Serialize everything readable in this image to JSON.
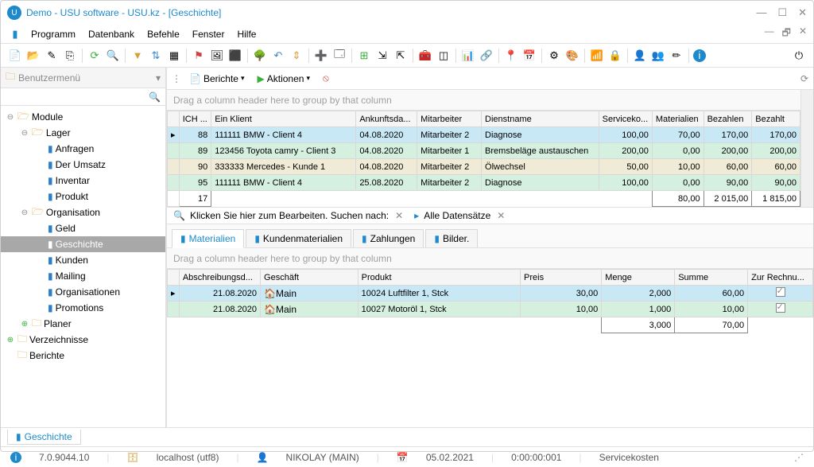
{
  "title": "Demo - USU software - USU.kz - [Geschichte]",
  "menu": [
    "Programm",
    "Datenbank",
    "Befehle",
    "Fenster",
    "Hilfe"
  ],
  "sidebar": {
    "title": "Benutzermenü",
    "items": [
      {
        "label": "Module"
      },
      {
        "label": "Lager"
      },
      {
        "label": "Anfragen"
      },
      {
        "label": "Der Umsatz"
      },
      {
        "label": "Inventar"
      },
      {
        "label": "Produkt"
      },
      {
        "label": "Organisation"
      },
      {
        "label": "Geld"
      },
      {
        "label": "Geschichte"
      },
      {
        "label": "Kunden"
      },
      {
        "label": "Mailing"
      },
      {
        "label": "Organisationen"
      },
      {
        "label": "Promotions"
      },
      {
        "label": "Planer"
      },
      {
        "label": "Verzeichnisse"
      },
      {
        "label": "Berichte"
      }
    ]
  },
  "mtoolbar": {
    "berichte": "Berichte",
    "aktionen": "Aktionen"
  },
  "group_hint": "Drag a column header here to group by that column",
  "grid1": {
    "cols": [
      "ICH ...",
      "Ein Klient",
      "Ankunftsda...",
      "Mitarbeiter",
      "Dienstname",
      "Serviceko...",
      "Materialien",
      "Bezahlen",
      "Bezahlt"
    ],
    "rows": [
      {
        "id": "88",
        "client": "111111 BMW - Client 4",
        "date": "04.08.2020",
        "emp": "Mitarbeiter 2",
        "svc": "Diagnose",
        "sk": "100,00",
        "mat": "70,00",
        "pay": "170,00",
        "paid": "170,00"
      },
      {
        "id": "89",
        "client": "123456 Toyota camry - Client 3",
        "date": "04.08.2020",
        "emp": "Mitarbeiter 1",
        "svc": "Bremsbeläge austauschen",
        "sk": "200,00",
        "mat": "0,00",
        "pay": "200,00",
        "paid": "200,00"
      },
      {
        "id": "90",
        "client": "333333 Mercedes - Kunde 1",
        "date": "04.08.2020",
        "emp": "Mitarbeiter 2",
        "svc": "Ölwechsel",
        "sk": "50,00",
        "mat": "10,00",
        "pay": "60,00",
        "paid": "60,00"
      },
      {
        "id": "95",
        "client": "111111 BMW - Client 4",
        "date": "25.08.2020",
        "emp": "Mitarbeiter 2",
        "svc": "Diagnose",
        "sk": "100,00",
        "mat": "0,00",
        "pay": "90,00",
        "paid": "90,00"
      }
    ],
    "totals": {
      "count": "17",
      "mat": "80,00",
      "pay": "2 015,00",
      "paid": "1 815,00"
    }
  },
  "searchbar": {
    "edit": "Klicken Sie hier zum Bearbeiten. Suchen nach:",
    "all": "Alle Datensätze"
  },
  "tabs": [
    "Materialien",
    "Kundenmaterialien",
    "Zahlungen",
    "Bilder."
  ],
  "grid2": {
    "cols": [
      "Abschreibungsd...",
      "Geschäft",
      "Produkt",
      "Preis",
      "Menge",
      "Summe",
      "Zur Rechnu..."
    ],
    "rows": [
      {
        "date": "21.08.2020",
        "shop": "Main",
        "prod": "10024 Luftfilter 1, Stck",
        "price": "30,00",
        "qty": "2,000",
        "sum": "60,00",
        "chk": true
      },
      {
        "date": "21.08.2020",
        "shop": "Main",
        "prod": "10027 Motoröl 1, Stck",
        "price": "10,00",
        "qty": "1,000",
        "sum": "10,00",
        "chk": true
      }
    ],
    "totals": {
      "qty": "3,000",
      "sum": "70,00"
    }
  },
  "bottab": "Geschichte",
  "status": {
    "ver": "7.0.9044.10",
    "host": "localhost (utf8)",
    "user": "NIKOLAY (MAIN)",
    "date": "05.02.2021",
    "time": "0:00:00:001",
    "page": "Servicekosten"
  }
}
